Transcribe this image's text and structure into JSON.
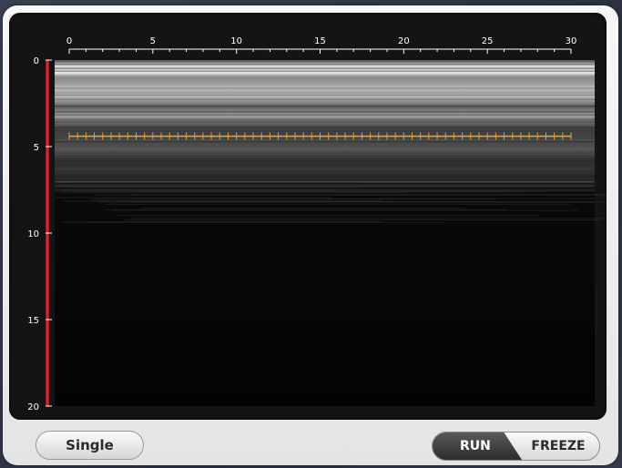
{
  "x_axis": {
    "ticks": [
      0,
      5,
      10,
      15,
      20,
      25,
      30
    ],
    "range": [
      0,
      30
    ]
  },
  "y_axis": {
    "ticks": [
      0,
      5,
      10,
      15,
      20
    ],
    "range": [
      0,
      20
    ]
  },
  "marker_line": {
    "depth": 4.4,
    "color": "#f0a030"
  },
  "depth_bar_color": "#e0141e",
  "buttons": {
    "single_label": "Single"
  },
  "mode_toggle": {
    "run_label": "RUN",
    "freeze_label": "FREEZE",
    "selected": "RUN"
  }
}
